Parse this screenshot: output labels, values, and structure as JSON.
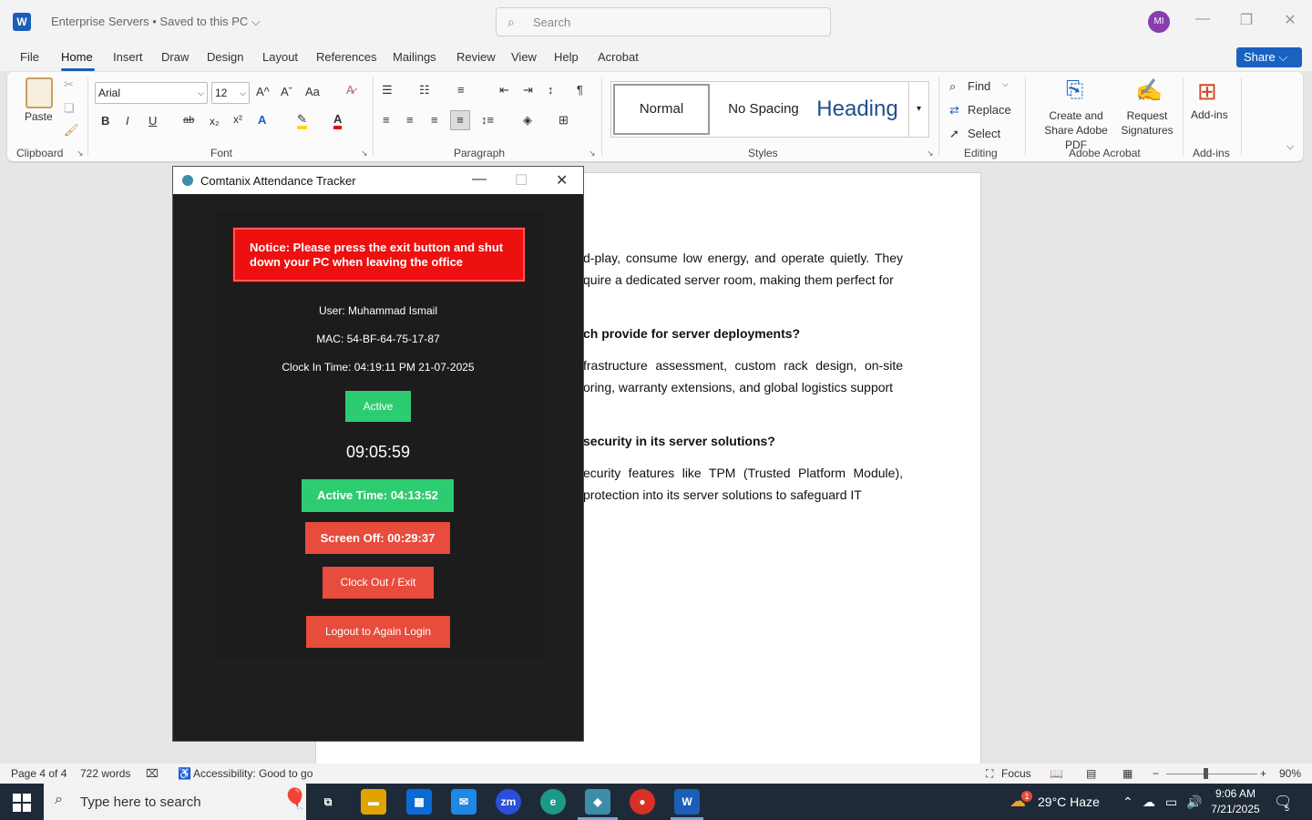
{
  "word": {
    "logo": "W",
    "title": "Enterprise Servers • Saved to this PC ⌵",
    "search_placeholder": "Search",
    "avatar": "MI",
    "menu": [
      "File",
      "Home",
      "Insert",
      "Draw",
      "Design",
      "Layout",
      "References",
      "Mailings",
      "Review",
      "View",
      "Help",
      "Acrobat"
    ],
    "share_label": "Share",
    "ribbon": {
      "clipboard": {
        "paste": "Paste",
        "label": "Clipboard"
      },
      "font": {
        "name": "Arial",
        "size": "12",
        "label": "Font",
        "bold": "B",
        "italic": "I",
        "underline": "U",
        "strike": "ab",
        "subscript": "x₂",
        "superscript": "x²",
        "grow": "A^",
        "shrink": "Aˇ",
        "case": "Aa"
      },
      "paragraph": {
        "label": "Paragraph"
      },
      "styles": {
        "normal": "Normal",
        "no_spacing": "No Spacing",
        "heading": "Heading",
        "label": "Styles"
      },
      "editing": {
        "find": "Find",
        "replace": "Replace",
        "select": "Select",
        "label": "Editing"
      },
      "acrobat": {
        "create": "Create and Share Adobe PDF",
        "request": "Request Signatures",
        "label": "Adobe Acrobat"
      },
      "addins": {
        "addins": "Add-ins",
        "label": "Add-ins"
      }
    },
    "doc": {
      "p1": "d-play, consume low energy, and operate quietly. They quire a dedicated server room, making them perfect for",
      "h1": "ch provide for server deployments?",
      "p2": "frastructure assessment, custom rack design, on-site oring, warranty extensions, and global logistics support",
      "h2": "security in its server solutions?",
      "p3": "ecurity features like TPM (Trusted Platform Module), protection into its server solutions to safeguard IT"
    },
    "status": {
      "page": "Page 4 of 4",
      "words": "722 words",
      "accessibility": "Accessibility: Good to go",
      "focus": "Focus",
      "zoom": "90%"
    }
  },
  "app": {
    "title": "Comtanix Attendance Tracker",
    "notice": "Notice: Please press the exit button and shut down your PC when leaving the office",
    "user": "User: Muhammad Ismail",
    "mac": "MAC: 54-BF-64-75-17-87",
    "clock_in": "Clock In Time: 04:19:11 PM 21-07-2025",
    "status": "Active",
    "timer": "09:05:59",
    "active_time": "Active Time: 04:13:52",
    "screen_off": "Screen Off: 00:29:37",
    "clock_out": "Clock Out / Exit",
    "logout": "Logout to Again Login"
  },
  "taskbar": {
    "search": "Type here to search",
    "weather": "29°C  Haze",
    "weather_badge": "1",
    "time": "9:06 AM",
    "date": "7/21/2025",
    "notif": "5"
  },
  "colors": {
    "accent": "#1a5eb8",
    "green": "#2ecc71",
    "red": "#e74c3c",
    "notice_red": "#ee0f0f"
  }
}
